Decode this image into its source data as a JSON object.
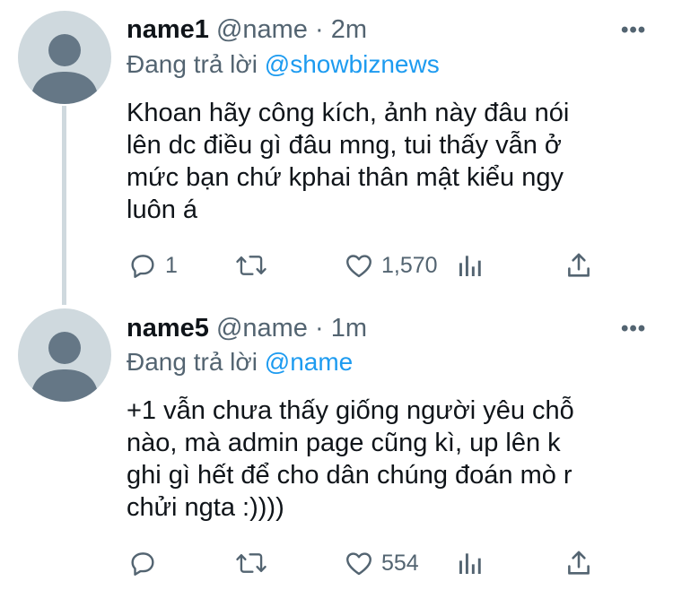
{
  "reply_label": "Đang trả lời",
  "tweets": [
    {
      "display_name": "name1",
      "handle": "@name",
      "separator": "·",
      "time": "2m",
      "reply_to": "@showbiznews",
      "body_lines": [
        "Khoan hãy công kích, ảnh này đâu nói",
        "lên dc điều gì đâu mng, tui thấy vẫn ở",
        "mức bạn chứ kphai thân mật kiểu ngy",
        "luôn á"
      ],
      "reply_count": "1",
      "retweet_count": "",
      "like_count": "1,570"
    },
    {
      "display_name": "name5",
      "handle": "@name",
      "separator": "·",
      "time": "1m",
      "reply_to": "@name",
      "body_lines": [
        "+1 vẫn chưa thấy giống người yêu chỗ",
        "nào, mà admin page cũng kì, up lên k",
        "ghi gì hết để cho dân chúng đoán mò r",
        "chửi ngta :))))"
      ],
      "reply_count": "",
      "retweet_count": "",
      "like_count": "554"
    }
  ],
  "icons": {
    "more": "more-horizontal-icon",
    "reply": "reply-bubble-icon",
    "retweet": "retweet-icon",
    "like": "heart-icon",
    "analytics": "analytics-bars-icon",
    "share": "share-upload-icon"
  },
  "colors": {
    "mention": "#1d9bf0",
    "secondary_text": "#536471",
    "avatar_bg": "#cfd9de",
    "avatar_figure": "#657786"
  }
}
